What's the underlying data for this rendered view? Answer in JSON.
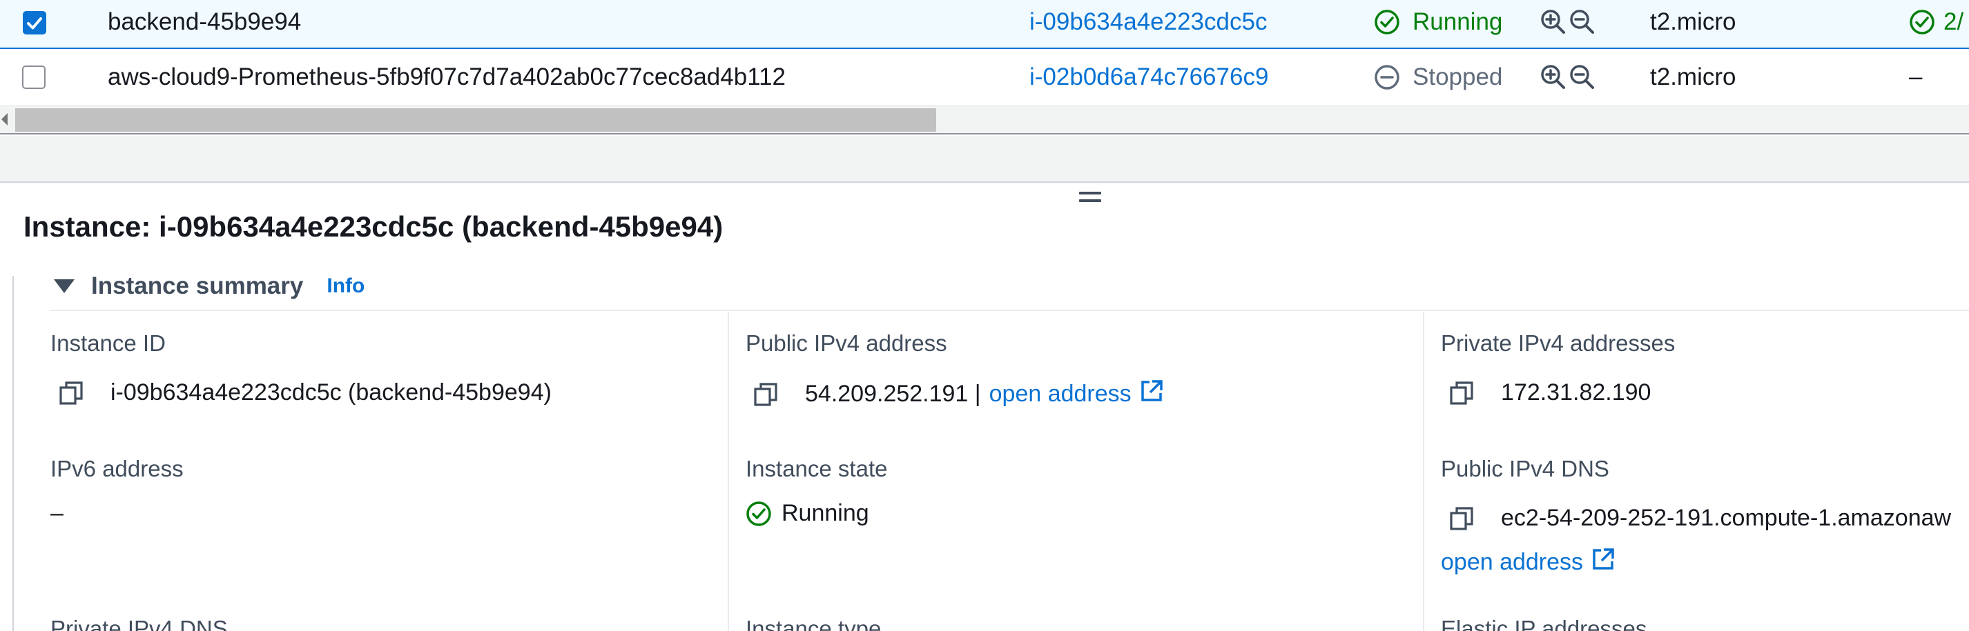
{
  "table": {
    "rows": [
      {
        "selected": true,
        "name": "backend-45b9e94",
        "instance_id": "i-09b634a4e223cdc5c",
        "state": "Running",
        "type": "t2.micro",
        "status_check": "2/"
      },
      {
        "selected": false,
        "name": "aws-cloud9-Prometheus-5fb9f07c7d7a402ab0c77cec8ad4b112",
        "instance_id": "i-02b0d6a74c76676c9",
        "state": "Stopped",
        "type": "t2.micro",
        "status_check": "–"
      }
    ]
  },
  "details": {
    "title": "Instance: i-09b634a4e223cdc5c (backend-45b9e94)",
    "summary_title": "Instance summary",
    "info_label": "Info",
    "fields": {
      "instance_id": {
        "label": "Instance ID",
        "value": "i-09b634a4e223cdc5c (backend-45b9e94)"
      },
      "public_ipv4": {
        "label": "Public IPv4 address",
        "value": "54.209.252.191 |",
        "link": "open address"
      },
      "private_ipv4": {
        "label": "Private IPv4 addresses",
        "value": "172.31.82.190"
      },
      "ipv6": {
        "label": "IPv6 address",
        "value": "–"
      },
      "instance_state": {
        "label": "Instance state",
        "value": "Running"
      },
      "public_dns": {
        "label": "Public IPv4 DNS",
        "value": "ec2-54-209-252-191.compute-1.amazonaw",
        "link": "open address"
      },
      "private_dns": {
        "label": "Private IPv4 DNS"
      },
      "instance_type": {
        "label": "Instance type"
      },
      "elastic_ip": {
        "label": "Elastic IP addresses"
      }
    }
  },
  "colors": {
    "link": "#0972d3",
    "success": "#037f0c",
    "stopped": "#5f6b7a",
    "selected_row_bg": "#f1faff"
  },
  "icons": [
    "checkbox-checked-icon",
    "checkbox-empty-icon",
    "status-ok-icon",
    "status-stopped-icon",
    "zoom-in-icon",
    "zoom-out-icon",
    "copy-icon",
    "external-link-icon",
    "caret-down-icon",
    "resize-handle-icon"
  ]
}
